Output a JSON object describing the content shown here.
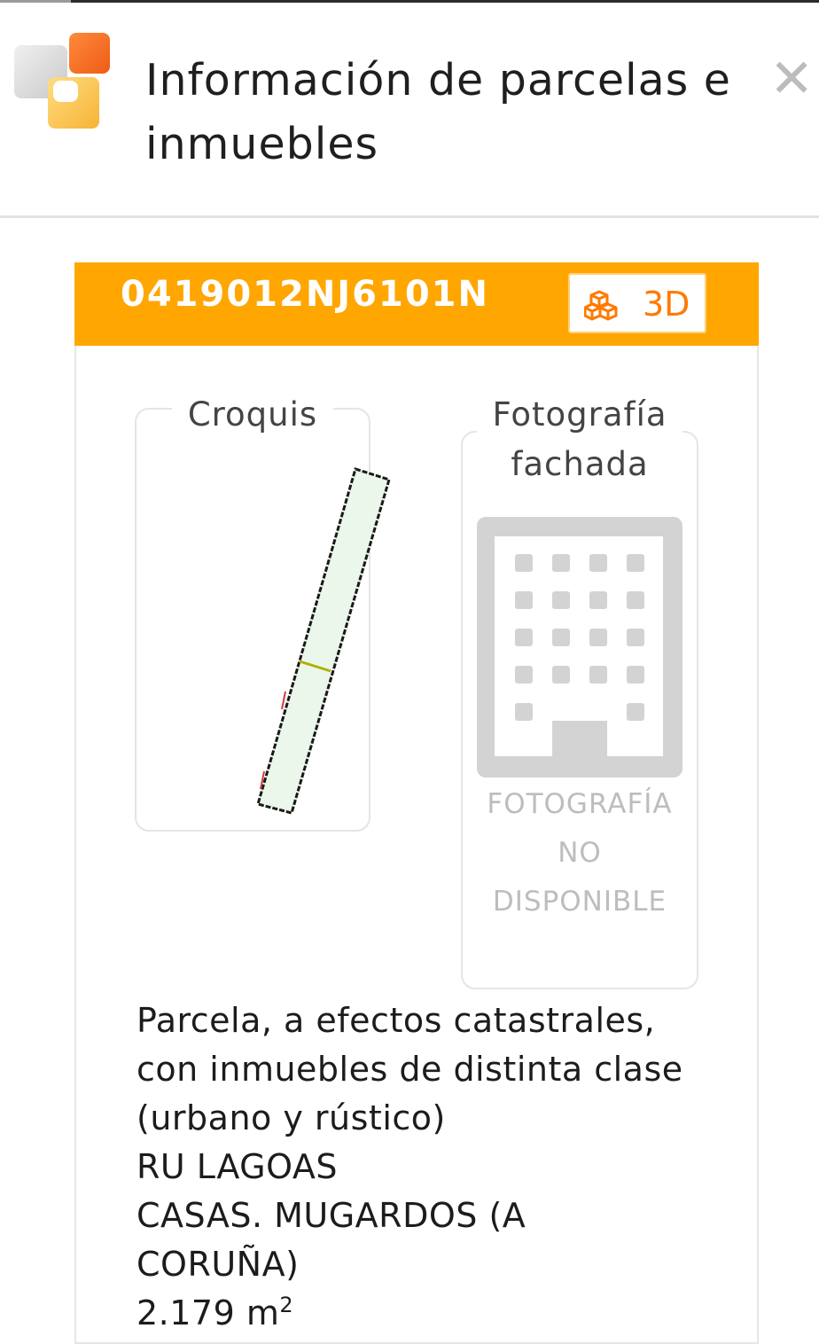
{
  "header": {
    "title": "Información de parcelas e inmuebles",
    "logo_icon": "catastro-logo-icon",
    "close_icon": "close-icon"
  },
  "parcel": {
    "reference": "0419012NJ6101N",
    "button_3d_label": "3D",
    "button_3d_icon": "cubes-icon",
    "header_color": "#ffa600"
  },
  "croquis": {
    "title": "Croquis"
  },
  "photo": {
    "title_line1": "Fotografía",
    "title_line2": "fachada",
    "placeholder_icon": "building-icon",
    "unavailable_line1": "FOTOGRAFÍA",
    "unavailable_line2": "NO",
    "unavailable_line3": "DISPONIBLE"
  },
  "description": {
    "line1": "Parcela, a efectos catastrales,",
    "line2": "con inmuebles de distinta clase",
    "line3": "(urbano y rústico)",
    "address_line1": "RU LAGOAS",
    "address_line2": "CASAS. MUGARDOS (A",
    "address_line3": "CORUÑA)",
    "area_value": "2.179 m",
    "area_exponent": "2"
  }
}
